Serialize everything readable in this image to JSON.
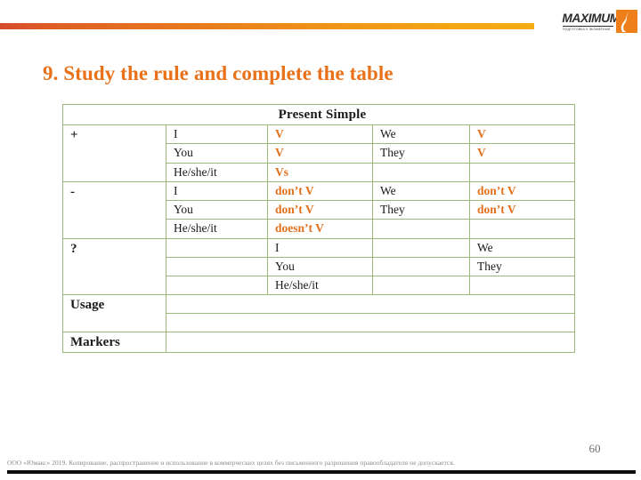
{
  "header": {
    "logo": {
      "wordmark": "MAXIMUM",
      "tagline": "ПОДГОТОВКА К ЭКЗАМЕНАМ",
      "mark_icon": "maximum-flame-mark-icon"
    },
    "accent_start_color": "#d64a2b",
    "accent_end_color": "#f7ac13"
  },
  "title": "9. Study the rule and complete the table",
  "title_color": "#e8711a",
  "table": {
    "header": "Present Simple",
    "header_fill": "#c9dfab",
    "border_color": "#9db87c",
    "verb_color": "#e2701c",
    "rows": [
      {
        "sign": "+",
        "lines": [
          {
            "subject": "I",
            "form": "V",
            "subject2": "We",
            "form2": "V"
          },
          {
            "subject": "You",
            "form": "V",
            "subject2": "They",
            "form2": "V"
          },
          {
            "subject": "He/she/it",
            "form": "Vs",
            "subject2": "",
            "form2": ""
          }
        ]
      },
      {
        "sign": "-",
        "lines": [
          {
            "subject": "I",
            "form": "don’t V",
            "subject2": "We",
            "form2": "don’t V"
          },
          {
            "subject": "You",
            "form": "don’t V",
            "subject2": "They",
            "form2": "don’t V"
          },
          {
            "subject": "He/she/it",
            "form": "doesn’t V",
            "subject2": "",
            "form2": ""
          }
        ]
      },
      {
        "sign": "?",
        "lines": [
          {
            "aux": "",
            "subject": "I",
            "aux2": "",
            "subject2": "We"
          },
          {
            "aux": "",
            "subject": "You",
            "aux2": "",
            "subject2": "They"
          },
          {
            "aux": "",
            "subject": "He/she/it",
            "aux2": "",
            "subject2": ""
          }
        ]
      }
    ],
    "usage_label": "Usage",
    "usage_values": [
      "",
      ""
    ],
    "markers_label": "Markers",
    "markers_value": ""
  },
  "footer": {
    "page_number": "60",
    "copyright": "ООО «Юмакс» 2019. Копирование, распространение и использование в коммерческих целях без письменного разрешения правообладателя не допускается."
  }
}
